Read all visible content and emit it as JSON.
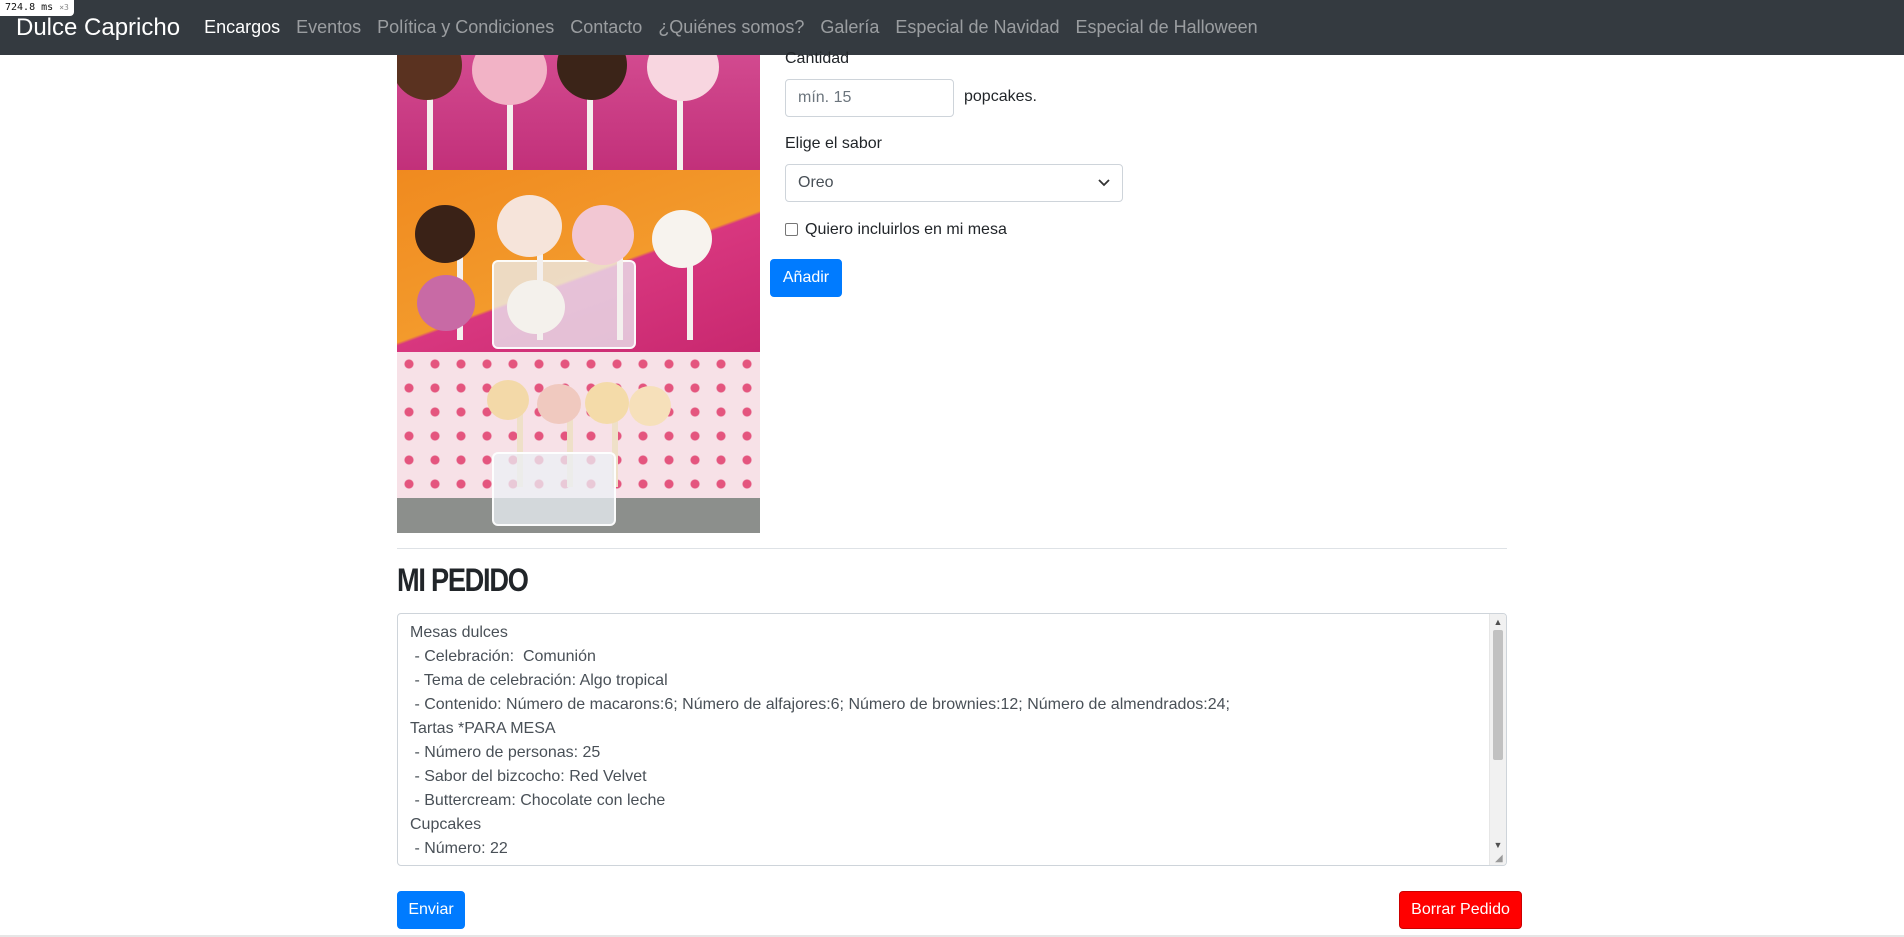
{
  "perf": {
    "value": "724.8",
    "unit": "ms",
    "mult": "×3"
  },
  "navbar": {
    "brand": "Dulce Capricho",
    "items": [
      {
        "label": "Encargos",
        "active": true
      },
      {
        "label": "Eventos"
      },
      {
        "label": "Política y Condiciones"
      },
      {
        "label": "Contacto"
      },
      {
        "label": "¿Quiénes somos?"
      },
      {
        "label": "Galería"
      },
      {
        "label": "Especial de Navidad"
      },
      {
        "label": "Especial de Halloween"
      }
    ]
  },
  "form": {
    "quantity_label": "Cantidad",
    "quantity_placeholder": "mín. 15",
    "quantity_unit": "popcakes.",
    "flavor_label": "Elige el sabor",
    "flavor_selected": "Oreo",
    "table_checkbox_label": "Quiero incluirlos en mi mesa",
    "add_button": "Añadir"
  },
  "order": {
    "title": "MI PEDIDO",
    "lines": [
      "Mesas dulces",
      " - Celebración:  Comunión",
      " - Tema de celebración: Algo tropical",
      " - Contenido: Número de macarons:6; Número de alfajores:6; Número de brownies:12; Número de almendrados:24;",
      "Tartas *PARA MESA",
      " - Número de personas: 25",
      " - Sabor del bizcocho: Red Velvet",
      " - Buttercream: Chocolate con leche",
      "Cupcakes",
      " - Número: 22"
    ],
    "send_button": "Enviar",
    "clear_button": "Borrar Pedido"
  },
  "colors": {
    "navbar": "#343a40",
    "primary": "#007bff",
    "danger": "#ff0000"
  }
}
